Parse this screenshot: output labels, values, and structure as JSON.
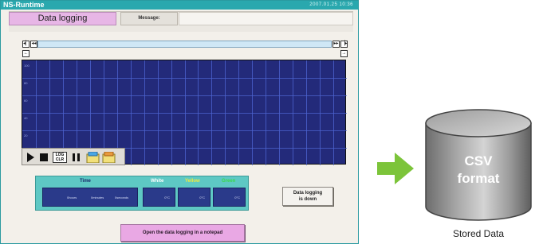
{
  "window": {
    "app_title": "NS-Runtime",
    "clock": "2007.01.25     10:36"
  },
  "header": {
    "title": "Data logging",
    "message_label": "Message:"
  },
  "graph": {
    "y_ticks": [
      "100",
      "80",
      "60",
      "40",
      "20",
      "0"
    ],
    "background": "#232a7a",
    "grid_color": "#4c63cf"
  },
  "controls": {
    "log_clear_label": "LOG\nCLR"
  },
  "legend": {
    "time_label": "Time",
    "series": [
      {
        "name": "White",
        "color": "#ffffff",
        "value": "0°C"
      },
      {
        "name": "Yellow",
        "color": "#f2ea3a",
        "value": "0°C"
      },
      {
        "name": "Green",
        "color": "#3bd84a",
        "value": "0°C"
      }
    ],
    "time_parts": [
      "0hours",
      "0minutes",
      "0seconds"
    ]
  },
  "buttons": {
    "down_label": "Data logging\nis down",
    "notepad_label": "Open the data logging in a notepad"
  },
  "storage": {
    "format_line1": "CSV",
    "format_line2": "format",
    "caption": "Stored Data"
  },
  "colors": {
    "arrow": "#7cc43a",
    "titlebar": "#2aa8ae",
    "panel": "#5ec8c4"
  }
}
